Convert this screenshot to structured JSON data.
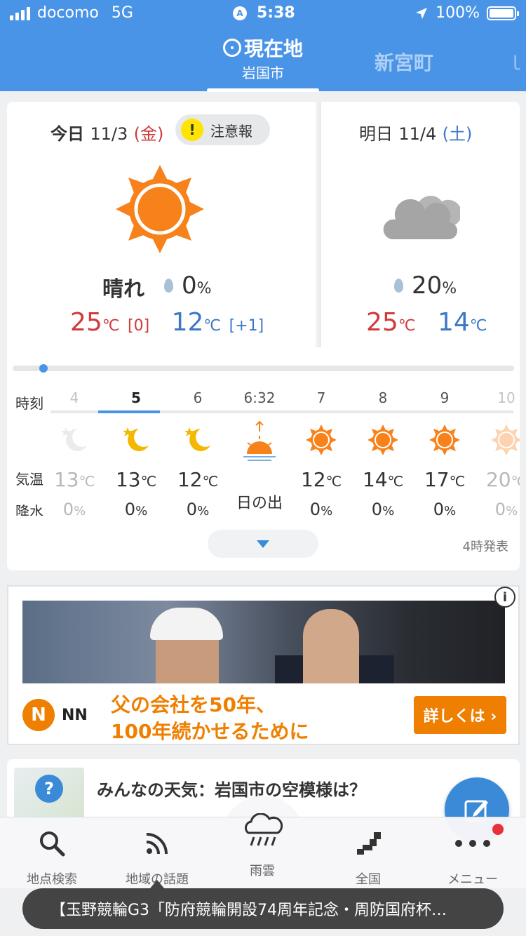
{
  "status_bar": {
    "carrier": "docomo",
    "network": "5G",
    "time": "5:38",
    "battery": "100%"
  },
  "locations": {
    "current_label": "現在地",
    "current_city": "岩国市",
    "next": "新宮町",
    "next_partial": "ｌ"
  },
  "today": {
    "label": "今日",
    "date": "11/3",
    "weekday": "(金)",
    "alert": "注意報",
    "condition": "晴れ",
    "rain_value": "0",
    "rain_unit": "%",
    "high": "25",
    "high_diff": "[0]",
    "low": "12",
    "low_diff": "[+1]",
    "deg": "℃"
  },
  "tomorrow": {
    "label": "明日",
    "date": "11/4",
    "weekday": "(土)",
    "rain_value": "20",
    "rain_unit": "%",
    "high": "25",
    "low": "14",
    "deg": "℃"
  },
  "hourly": {
    "row_labels": {
      "time": "時刻",
      "temp": "気温",
      "precip": "降水"
    },
    "deg": "℃",
    "pct": "%",
    "hours": [
      {
        "hour": "4",
        "icon": "moon-cloud-icon",
        "temp": "13",
        "precip": "0"
      },
      {
        "hour": "5",
        "icon": "moon-icon",
        "temp": "13",
        "precip": "0"
      },
      {
        "hour": "6",
        "icon": "moon-icon",
        "temp": "12",
        "precip": "0"
      },
      {
        "hour": "6:32",
        "icon": "sunrise-icon",
        "temp": "",
        "precip": "日の出"
      },
      {
        "hour": "7",
        "icon": "sun-icon",
        "temp": "12",
        "precip": "0"
      },
      {
        "hour": "8",
        "icon": "sun-icon",
        "temp": "14",
        "precip": "0"
      },
      {
        "hour": "9",
        "icon": "sun-icon",
        "temp": "17",
        "precip": "0"
      },
      {
        "hour": "10",
        "icon": "sun-icon",
        "temp": "20",
        "precip": "0"
      }
    ],
    "issued": "4時発表"
  },
  "ad": {
    "brand": "NN",
    "copy_line1": "父の会社を50年、",
    "copy_line2": "100年続かせるために",
    "button": "詳しくは ›"
  },
  "community": {
    "title": "みんなの天気：岩国市の空模様は？"
  },
  "bottom_nav": [
    {
      "label": "地点検索",
      "icon": "search-icon"
    },
    {
      "label": "地域の話題",
      "icon": "rss-icon"
    },
    {
      "label": "雨雲",
      "icon": "rain-cloud-icon"
    },
    {
      "label": "全国",
      "icon": "japan-map-icon"
    },
    {
      "label": "メニュー",
      "icon": "more-icon"
    }
  ],
  "ticker": "【玉野競輪G3「防府競輪開設74周年記念・周防国府杯…",
  "colors": {
    "header_blue": "#4a94e8",
    "high_red": "#d03a3a",
    "low_blue": "#3c78c8",
    "sun_orange": "#f7821b",
    "ad_orange": "#ee7f00"
  }
}
